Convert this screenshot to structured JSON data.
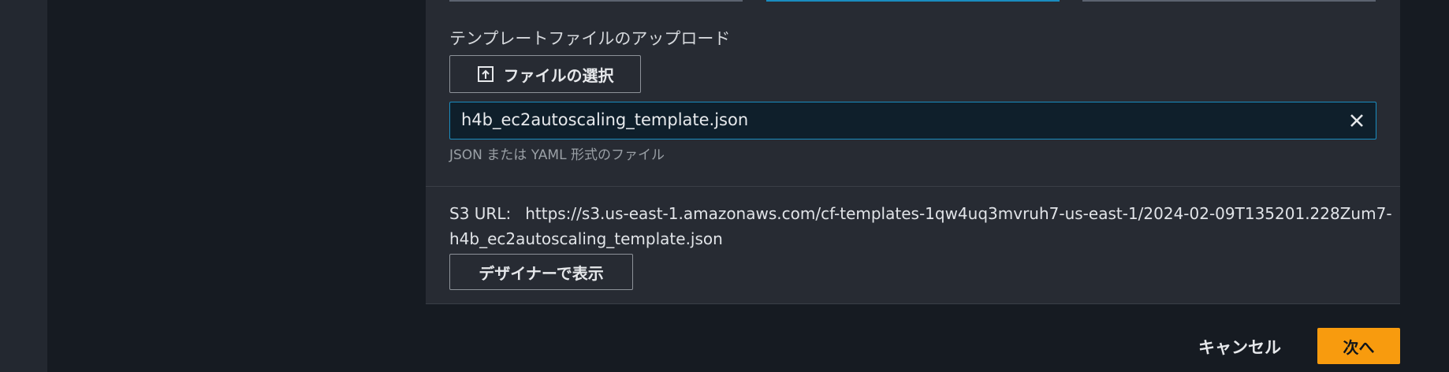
{
  "upload": {
    "section_label": "テンプレートファイルのアップロード",
    "choose_button_label": "ファイルの選択",
    "choose_button_icon": "upload-icon",
    "selected_file": "h4b_ec2autoscaling_template.json",
    "clear_icon": "close-icon",
    "hint": "JSON または YAML 形式のファイル"
  },
  "s3": {
    "label": "S3 URL:",
    "url_line1": "https://s3.us-east-1.amazonaws.com/cf-templates-1qw4uq3mvruh7-us-east-1/2024-02-09T135201.228Zum7-",
    "url_line2": "h4b_ec2autoscaling_template.json",
    "designer_button_label": "デザイナーで表示"
  },
  "footer": {
    "cancel_label": "キャンセル",
    "next_label": "次へ"
  },
  "colors": {
    "accent": "#1a8cbf",
    "primary_button": "#f89b0e",
    "panel": "#272b33",
    "background": "#161b22"
  }
}
